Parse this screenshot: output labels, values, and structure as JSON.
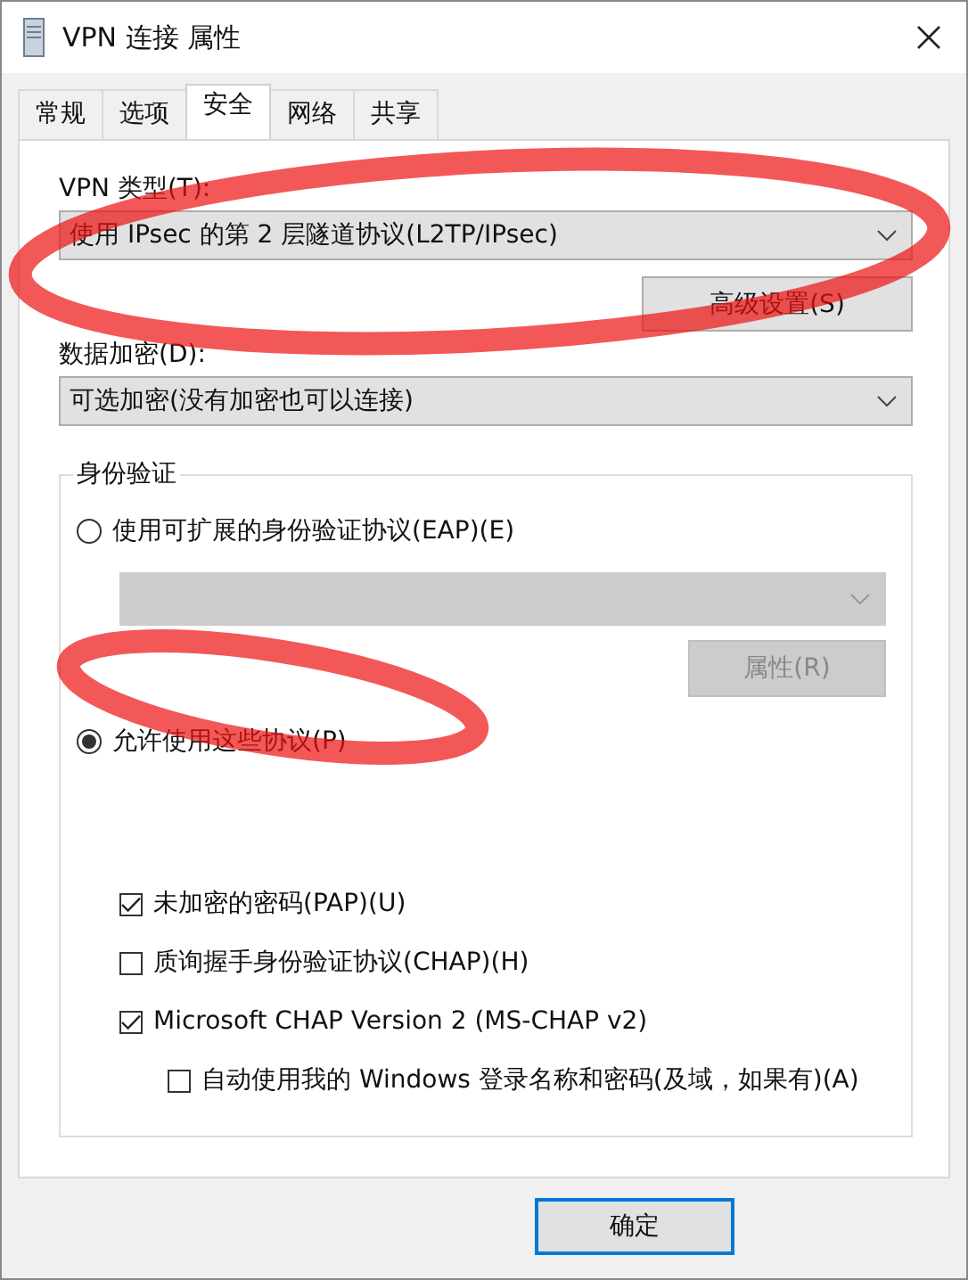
{
  "window": {
    "title": "VPN 连接 属性"
  },
  "tabs": [
    {
      "label": "常规",
      "selected": false
    },
    {
      "label": "选项",
      "selected": false
    },
    {
      "label": "安全",
      "selected": true
    },
    {
      "label": "网络",
      "selected": false
    },
    {
      "label": "共享",
      "selected": false
    }
  ],
  "vpn_type": {
    "label": "VPN 类型(T):",
    "value": "使用 IPsec 的第 2 层隧道协议(L2TP/IPsec)"
  },
  "advanced_button": {
    "label": "高级设置(S)",
    "disabled": false
  },
  "encryption": {
    "label": "数据加密(D):",
    "value": "可选加密(没有加密也可以连接)"
  },
  "authentication": {
    "title": "身份验证",
    "options": [
      {
        "label": "使用可扩展的身份验证协议(EAP)(E)",
        "selected": false
      },
      {
        "label": "允许使用这些协议(P)",
        "selected": true
      }
    ],
    "eap_dropdown": {
      "disabled": true
    },
    "properties_button": {
      "label": "属性(R)",
      "disabled": true
    },
    "protocols": [
      {
        "label": "未加密的密码(PAP)(U)",
        "checked": true
      },
      {
        "label": "质询握手身份验证协议(CHAP)(H)",
        "checked": false
      },
      {
        "label": "Microsoft CHAP Version 2 (MS-CHAP v2)",
        "checked": true
      }
    ],
    "auto_logon": {
      "label": "自动使用我的 Windows 登录名称和密码(及域，如果有)(A)",
      "checked": false
    }
  },
  "buttons": [
    {
      "label": "确定"
    }
  ]
}
